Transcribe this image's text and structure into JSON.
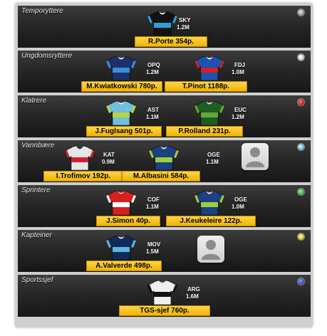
{
  "team": {
    "sections": [
      {
        "key": "time_trial",
        "title": "Temporyttere",
        "dot_color": "#9a9a9a",
        "riders": [
          {
            "name": "R.Porte 354p.",
            "team": "SKY",
            "price": "1.2M",
            "jersey_colors": [
              "#101010",
              "#2aa0e0",
              "#ffffff"
            ]
          }
        ]
      },
      {
        "key": "youth",
        "title": "Ungdomsryttere",
        "dot_color": "#ffffff",
        "riders": [
          {
            "name": "M.Kwiatkowski 780p.",
            "team": "OPQ",
            "price": "1.2M",
            "jersey_colors": [
              "#1a2f6b",
              "#3a8fd6",
              "#ffffff"
            ]
          },
          {
            "name": "T.Pinot 1188p.",
            "team": "FDJ",
            "price": "1.0M",
            "jersey_colors": [
              "#1f4fb3",
              "#d42020",
              "#ffffff"
            ]
          }
        ]
      },
      {
        "key": "climbers",
        "title": "Klatrere",
        "dot_color": "#d10000",
        "riders": [
          {
            "name": "J.Fuglsang 501p.",
            "team": "AST",
            "price": "1.1M",
            "jersey_colors": [
              "#6fc0e0",
              "#b7d63a",
              "#ffffff"
            ]
          },
          {
            "name": "P.Rolland 231p.",
            "team": "EUC",
            "price": "1.2M",
            "jersey_colors": [
              "#1d5e22",
              "#66a83a",
              "#f0f0f0"
            ]
          }
        ]
      },
      {
        "key": "water_carriers",
        "title": "Vannbære",
        "dot_color": "#3fb2ea",
        "riders": [
          {
            "name": "I.Trofimov 192p.",
            "team": "KAT",
            "price": "0.9M",
            "jersey_colors": [
              "#e8e8e8",
              "#d01e2a",
              "#1e3a8a"
            ]
          },
          {
            "name": "M.Albasini 584p.",
            "team": "OGE",
            "price": "1.1M",
            "jersey_colors": [
              "#1a3f80",
              "#9bd23a",
              "#ffffff"
            ]
          }
        ]
      },
      {
        "key": "sprinters",
        "title": "Sprintere",
        "dot_color": "#1eaa1e",
        "riders": [
          {
            "name": "J.Simon 40p.",
            "team": "COF",
            "price": "1.1M",
            "jersey_colors": [
              "#d81e1e",
              "#ffffff",
              "#f5b5b5"
            ]
          },
          {
            "name": "J.Keukeleire 122p.",
            "team": "OGE",
            "price": "1.0M",
            "jersey_colors": [
              "#1a3f80",
              "#9bd23a",
              "#ffffff"
            ]
          }
        ]
      },
      {
        "key": "captains",
        "title": "Kapteiner",
        "dot_color": "#e8c400",
        "riders": [
          {
            "name": "A.Valverde 498p.",
            "team": "MOV",
            "price": "1.5M",
            "jersey_colors": [
              "#0e2a5a",
              "#5fb7e0",
              "#ffffff"
            ]
          }
        ]
      },
      {
        "key": "sports_director",
        "title": "Sportssjef",
        "dot_color": "#2230b8",
        "riders": [
          {
            "name": "TGS-sjef 760p.",
            "team": "ARG",
            "price": "1.6M",
            "jersey_colors": [
              "#f2f2f2",
              "#111111",
              "#cccccc"
            ]
          }
        ]
      }
    ]
  }
}
